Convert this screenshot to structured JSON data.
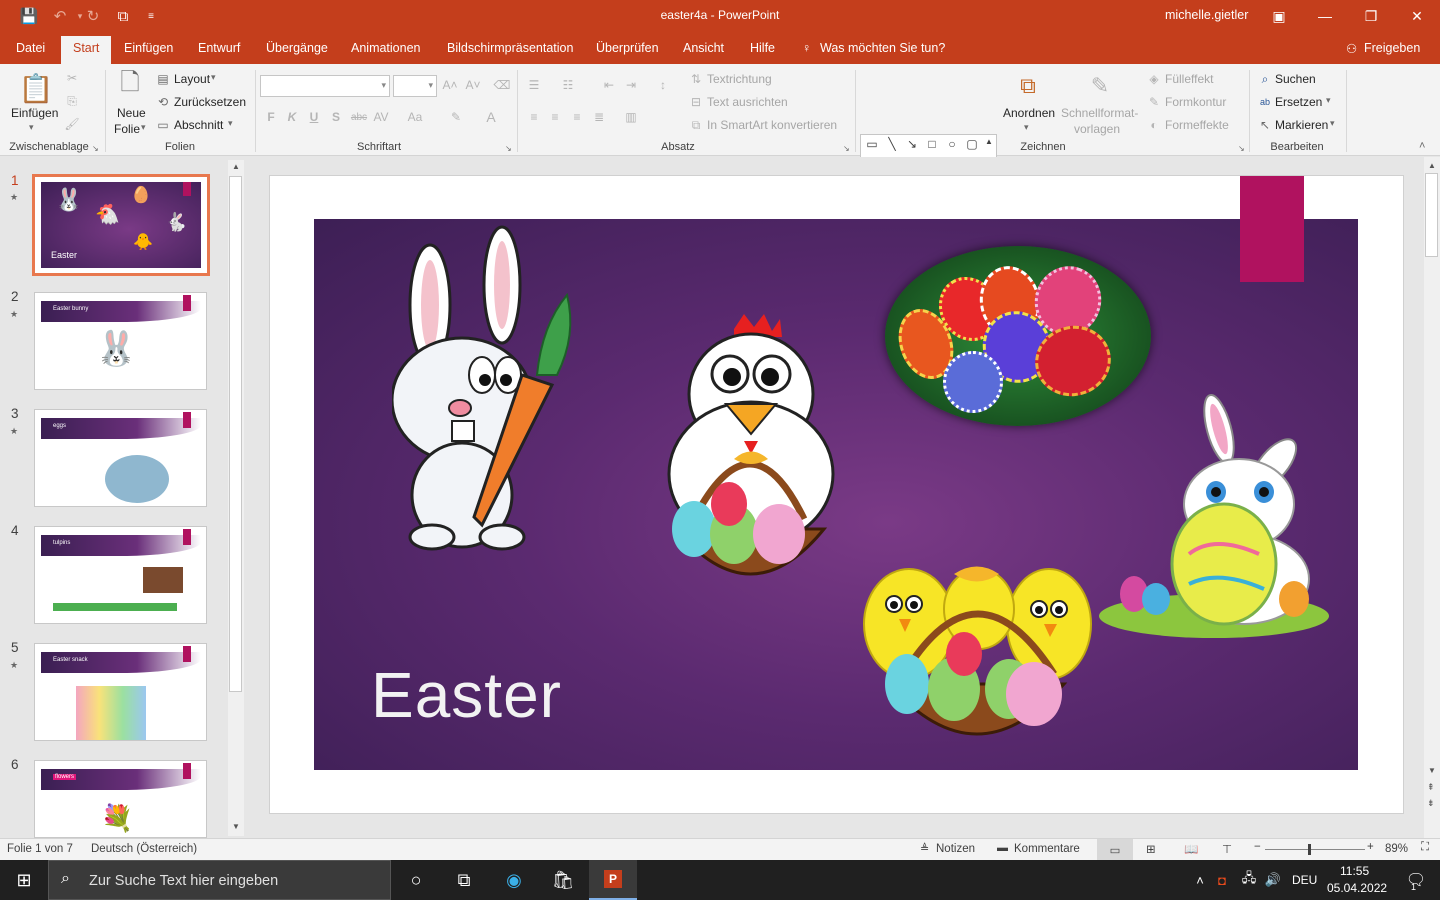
{
  "window": {
    "document_title": "easter4a  -  PowerPoint",
    "user": "michelle.gietler",
    "controls": {
      "ribbon_display": "▣",
      "minimize": "—",
      "restore": "❐",
      "close": "✕"
    }
  },
  "ribbon_tabs": [
    "Datei",
    "Start",
    "Einfügen",
    "Entwurf",
    "Übergänge",
    "Animationen",
    "Bildschirmpräsentation",
    "Überprüfen",
    "Ansicht",
    "Hilfe"
  ],
  "tell_me": "Was möchten Sie tun?",
  "share": "Freigeben",
  "ribbon": {
    "groups": {
      "clipboard": "Zwischenablage",
      "slides": "Folien",
      "font": "Schriftart",
      "paragraph": "Absatz",
      "drawing": "Zeichnen",
      "editing": "Bearbeiten"
    },
    "clipboard": {
      "paste": "Einfügen"
    },
    "slides": {
      "new_slide_line1": "Neue",
      "new_slide_line2": "Folie",
      "layout": "Layout",
      "reset": "Zurücksetzen",
      "section": "Abschnitt"
    },
    "font": {
      "bold": "F",
      "italic": "K",
      "underline": "U",
      "shadow": "S",
      "strike": "abc",
      "spacing": "AV",
      "case": "Aa",
      "color": "A"
    },
    "paragraph": {
      "text_direction": "Textrichtung",
      "align_text": "Text ausrichten",
      "smartart": "In SmartArt konvertieren"
    },
    "drawing": {
      "arrange": "Anordnen",
      "quickstyles_line1": "Schnellformat-",
      "quickstyles_line2": "vorlagen",
      "fill": "Fülleffekt",
      "outline": "Formkontur",
      "effects": "Formeffekte"
    },
    "editing": {
      "find": "Suchen",
      "replace": "Ersetzen",
      "select": "Markieren"
    }
  },
  "slides": [
    {
      "num": "1",
      "title": "Easter"
    },
    {
      "num": "2",
      "title": "Easter bunny"
    },
    {
      "num": "3",
      "title": "eggs"
    },
    {
      "num": "4",
      "title": "tulpins"
    },
    {
      "num": "5",
      "title": "Easter snack"
    },
    {
      "num": "6",
      "title": "flowers"
    }
  ],
  "current_slide": {
    "title": "Easter"
  },
  "status": {
    "slide_info": "Folie 1 von 7",
    "language": "Deutsch (Österreich)",
    "notes": "Notizen",
    "comments": "Kommentare",
    "zoom": "89%",
    "zoom_level": 0.44
  },
  "taskbar": {
    "search_placeholder": "Zur Suche Text hier eingeben",
    "language": "DEU",
    "time": "11:55",
    "date": "05.04.2022",
    "notifications": "1"
  },
  "colors": {
    "accent": "#c43e1c",
    "slide_tag": "#b0125f"
  }
}
